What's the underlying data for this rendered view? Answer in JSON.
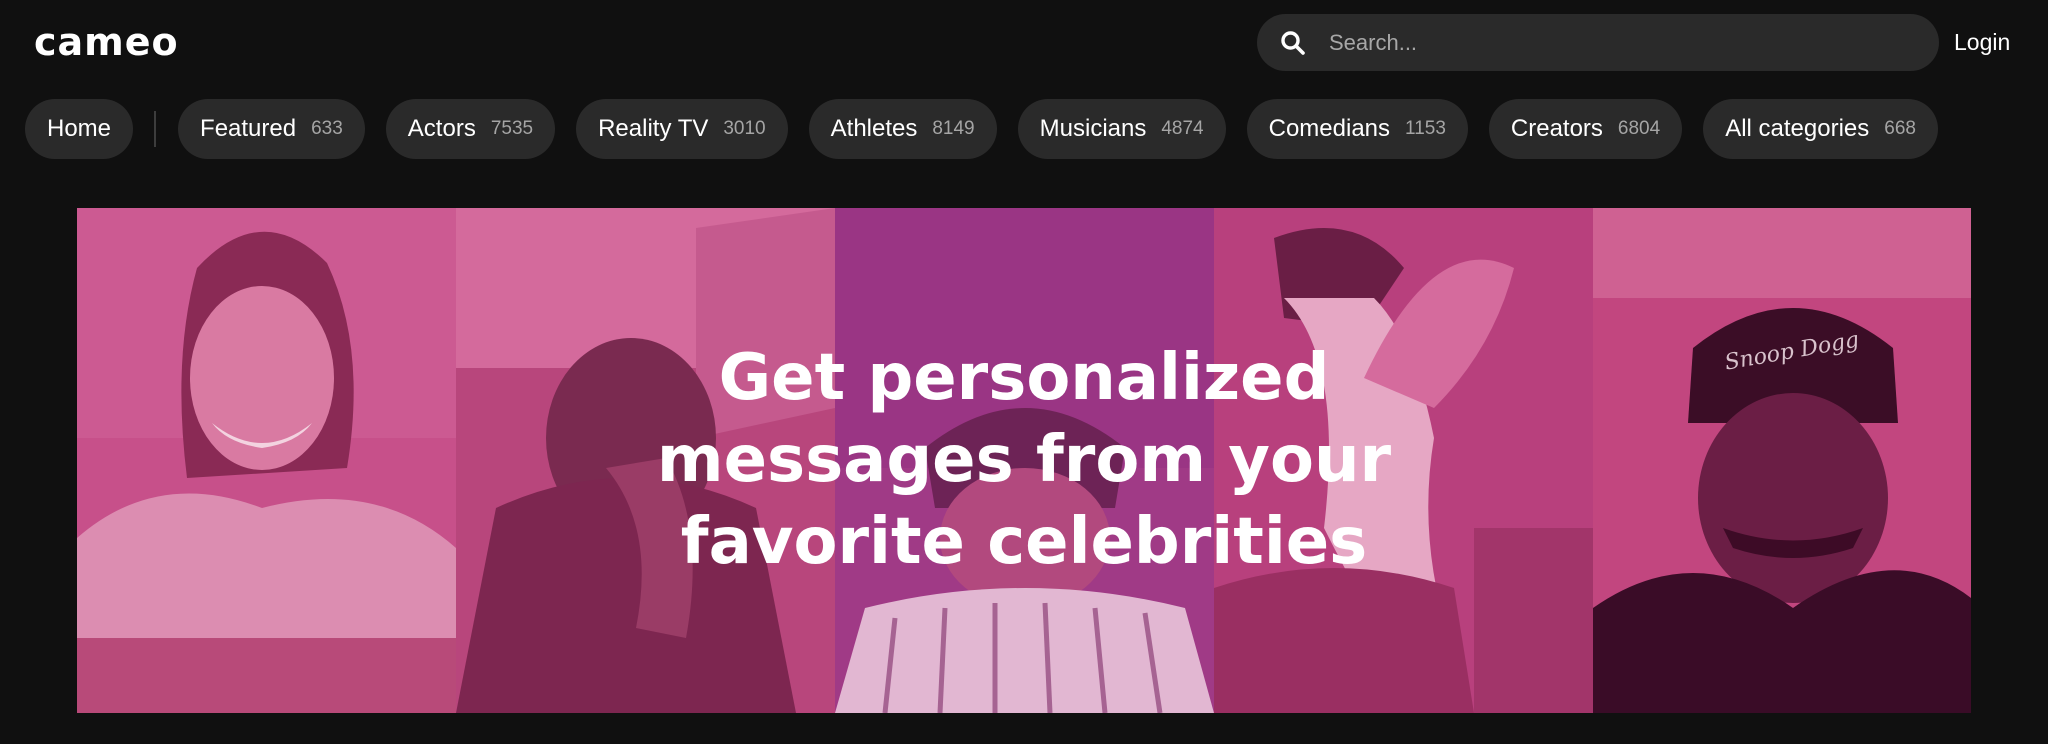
{
  "header": {
    "logo": "cameo",
    "search": {
      "placeholder": "Search..."
    },
    "login_label": "Login"
  },
  "categories": [
    {
      "label": "Home",
      "count": ""
    },
    {
      "label": "Featured",
      "count": "633"
    },
    {
      "label": "Actors",
      "count": "7535"
    },
    {
      "label": "Reality TV",
      "count": "3010"
    },
    {
      "label": "Athletes",
      "count": "8149"
    },
    {
      "label": "Musicians",
      "count": "4874"
    },
    {
      "label": "Comedians",
      "count": "1153"
    },
    {
      "label": "Creators",
      "count": "6804"
    },
    {
      "label": "All categories",
      "count": "668"
    }
  ],
  "hero": {
    "title": "Get personalized messages from your favorite celebrities",
    "panel_tint": "#c2467f",
    "panels": [
      "celebrity-photo-1",
      "celebrity-photo-2",
      "celebrity-photo-3",
      "celebrity-photo-4",
      "celebrity-photo-5"
    ],
    "beanie_text": "Snoop Dogg"
  },
  "colors": {
    "background": "#101010",
    "pill": "#2a2a2a",
    "muted_text": "#a5a5a5",
    "hero_pink": "#c2467f",
    "hero_magenta": "#a03a86"
  }
}
